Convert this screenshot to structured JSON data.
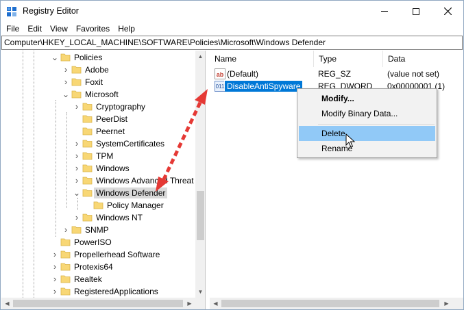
{
  "window": {
    "title": "Registry Editor",
    "app_icon": "registry-editor-icon"
  },
  "menu": [
    "File",
    "Edit",
    "View",
    "Favorites",
    "Help"
  ],
  "address": "Computer\\HKEY_LOCAL_MACHINE\\SOFTWARE\\Policies\\Microsoft\\Windows Defender",
  "tree": {
    "items": [
      {
        "label": "Policies",
        "expander": "expanded"
      },
      {
        "label": "Adobe",
        "expander": "collapsed"
      },
      {
        "label": "Foxit",
        "expander": "collapsed"
      },
      {
        "label": "Microsoft",
        "expander": "expanded"
      },
      {
        "label": "Cryptography",
        "expander": "collapsed"
      },
      {
        "label": "PeerDist",
        "expander": "none"
      },
      {
        "label": "Peernet",
        "expander": "none"
      },
      {
        "label": "SystemCertificates",
        "expander": "collapsed"
      },
      {
        "label": "TPM",
        "expander": "collapsed"
      },
      {
        "label": "Windows",
        "expander": "collapsed"
      },
      {
        "label": "Windows Advanced Threat Pro",
        "expander": "collapsed"
      },
      {
        "label": "Windows Defender",
        "expander": "expanded",
        "selected": true
      },
      {
        "label": "Policy Manager",
        "expander": "none"
      },
      {
        "label": "Windows NT",
        "expander": "collapsed"
      },
      {
        "label": "SNMP",
        "expander": "collapsed"
      },
      {
        "label": "PowerISO",
        "expander": "none"
      },
      {
        "label": "Propellerhead Software",
        "expander": "collapsed"
      },
      {
        "label": "Protexis64",
        "expander": "collapsed"
      },
      {
        "label": "Realtek",
        "expander": "collapsed"
      },
      {
        "label": "RegisteredApplications",
        "expander": "collapsed"
      }
    ]
  },
  "list": {
    "columns": [
      "Name",
      "Type",
      "Data"
    ],
    "rows": [
      {
        "icon": "string-value-icon",
        "icon_text": "ab",
        "name": "(Default)",
        "type": "REG_SZ",
        "data": "(value not set)",
        "selected": false
      },
      {
        "icon": "dword-value-icon",
        "icon_text": "011",
        "name": "DisableAntiSpyware",
        "type": "REG_DWORD",
        "data": "0x00000001 (1)",
        "selected": true
      }
    ]
  },
  "context_menu": {
    "items": [
      {
        "label": "Modify...",
        "bold": true
      },
      {
        "label": "Modify Binary Data..."
      },
      {
        "label": "Delete",
        "hover": true
      },
      {
        "label": "Rename"
      }
    ]
  },
  "colors": {
    "selection": "#0078d7",
    "menu_hover": "#91c9f7",
    "annotation_arrow": "#e53935",
    "folder": "#f8d775"
  }
}
